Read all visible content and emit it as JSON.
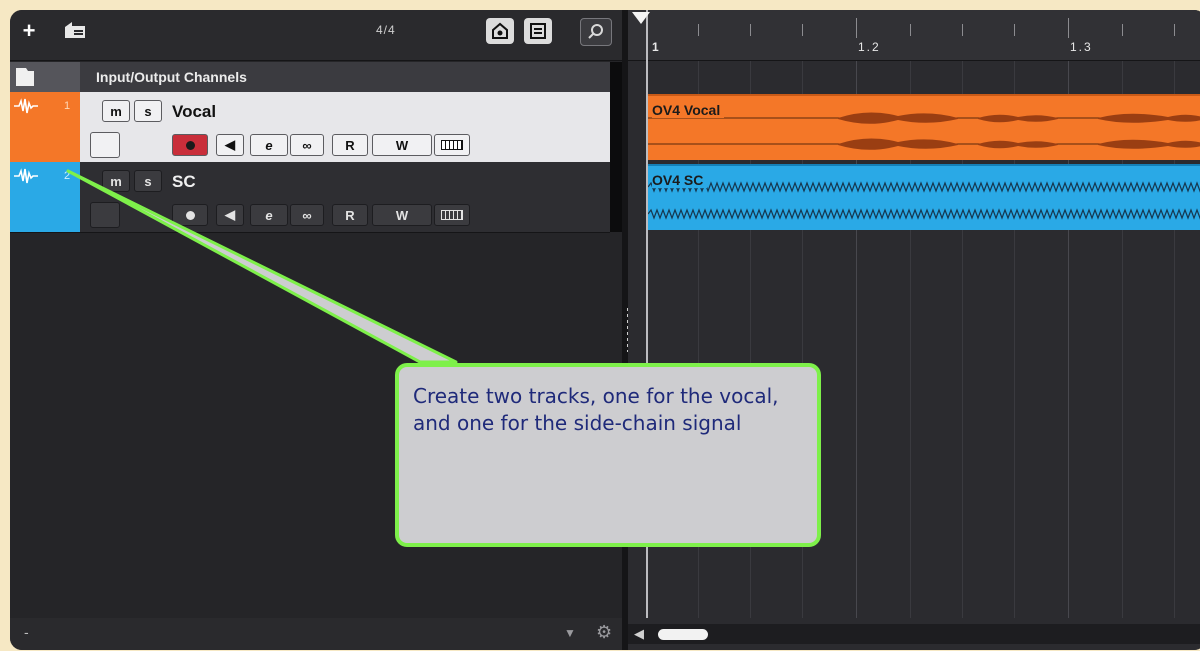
{
  "toolbar": {
    "add_track_icon": "plus-icon",
    "folder_icon": "folder-track-icon",
    "time_signature": "4/4",
    "inspector_icon": "inspector-icon",
    "list_icon": "list-icon",
    "search_icon": "search-icon"
  },
  "io_channels": {
    "title": "Input/Output Channels"
  },
  "tracks": [
    {
      "number": "1",
      "name": "Vocal",
      "color": "#f47728",
      "mute_label": "m",
      "solo_label": "s",
      "read_label": "R",
      "write_label": "W",
      "record_armed": true
    },
    {
      "number": "2",
      "name": "SC",
      "color": "#2aa9e6",
      "mute_label": "m",
      "solo_label": "s",
      "read_label": "R",
      "write_label": "W",
      "record_armed": false
    }
  ],
  "ruler": {
    "markers": [
      "1",
      "1.2",
      "1.3"
    ]
  },
  "regions": [
    {
      "name": "OV4 Vocal",
      "color": "#f47728"
    },
    {
      "name": "OV4 SC",
      "color": "#2aa9e6"
    }
  ],
  "bottom": {
    "minus": "-"
  },
  "callout": {
    "text": "Create two tracks, one for the vocal, and one for the side-chain signal",
    "border_color": "#7ef04a",
    "text_color": "#1f2a7a"
  }
}
